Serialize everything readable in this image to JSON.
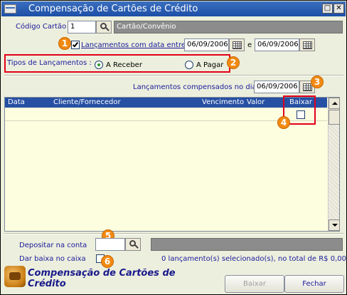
{
  "window": {
    "title": "Compensação de Cartões de Crédito"
  },
  "cartao": {
    "label": "Código Cartão",
    "code_value": "1",
    "name_value": "Cartão/Convênio"
  },
  "periodo": {
    "checked": true,
    "label": "Lançamentos com data entre",
    "start_date": "06/09/2006",
    "and_label": "e",
    "end_date": "06/09/2006"
  },
  "tipos": {
    "label": "Tipos de Lançamentos :",
    "receber_label": "A Receber",
    "pagar_label": "A Pagar",
    "selected": "A Receber"
  },
  "compensados": {
    "label": "Lançamentos compensados no dia",
    "date": "06/09/2006"
  },
  "grid": {
    "columns": [
      "Data",
      "Cliente/Fornecedor",
      "Vencimento",
      "Valor",
      "Baixar"
    ],
    "rows": []
  },
  "deposito": {
    "label": "Depositar na conta",
    "value": ""
  },
  "baixa_caixa": {
    "label": "Dar baixa no caixa",
    "checked": false
  },
  "status_text": "0 lançamento(s) selecionado(s), no total de R$ 0,00",
  "footer": {
    "title": "Compensação de Cartões de Crédito",
    "baixar_label": "Baixar",
    "fechar_label": "Fechar"
  },
  "badges": [
    "1",
    "2",
    "3",
    "4",
    "5",
    "6"
  ],
  "colors": {
    "titlebar": "#1c4fa6",
    "grid_header": "#2650a3",
    "highlight_box": "#e2001a",
    "badge": "#f28a12",
    "panel_bg": "#ecefdd",
    "grid_bg": "#fdfde0"
  }
}
